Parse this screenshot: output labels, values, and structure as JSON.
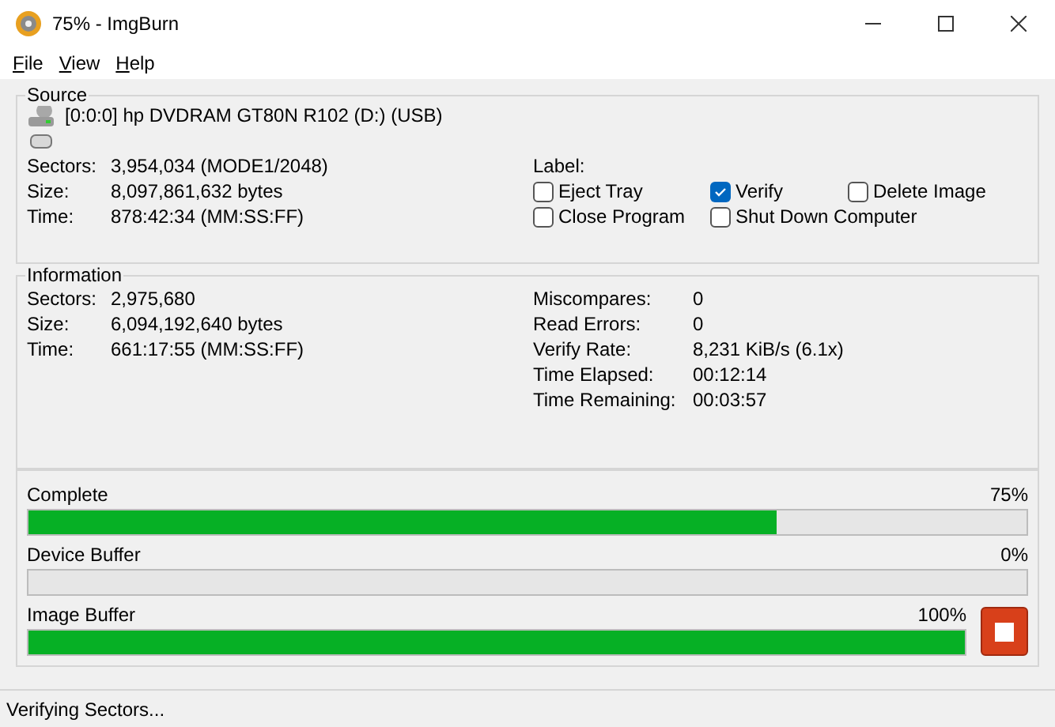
{
  "window": {
    "title": "75% - ImgBurn"
  },
  "menu": [
    {
      "label": "File"
    },
    {
      "label": "View"
    },
    {
      "label": "Help"
    }
  ],
  "source": {
    "title": "Source",
    "device": "[0:0:0] hp DVDRAM GT80N R102 (D:) (USB)",
    "fields": [
      {
        "label": "Sectors:",
        "value": "3,954,034 (MODE1/2048)"
      },
      {
        "label": "Size:",
        "value": "8,097,861,632 bytes"
      },
      {
        "label": "Time:",
        "value": "878:42:34 (MM:SS:FF)"
      }
    ],
    "label_caption": "Label:",
    "options": [
      {
        "label": "Eject Tray",
        "checked": false
      },
      {
        "label": "Verify",
        "checked": true
      },
      {
        "label": "Delete Image",
        "checked": false
      },
      {
        "label": "Close Program",
        "checked": false
      },
      {
        "label": "Shut Down Computer",
        "checked": false
      }
    ]
  },
  "information": {
    "title": "Information",
    "fields": [
      {
        "label": "Sectors:",
        "value": "2,975,680"
      },
      {
        "label": "Size:",
        "value": "6,094,192,640 bytes"
      },
      {
        "label": "Time:",
        "value": "661:17:55 (MM:SS:FF)"
      }
    ],
    "stats": [
      {
        "label": "Miscompares:",
        "value": "0"
      },
      {
        "label": "Read Errors:",
        "value": "0"
      },
      {
        "label": "Verify Rate:",
        "value": "8,231 KiB/s (6.1x)"
      },
      {
        "label": "Time Elapsed:",
        "value": "00:12:14"
      },
      {
        "label": "Time Remaining:",
        "value": "00:03:57"
      }
    ]
  },
  "progress": [
    {
      "label": "Complete",
      "reading": "75%",
      "level": 0.75
    },
    {
      "label": "Device Buffer",
      "reading": "0%",
      "level": 0
    },
    {
      "label": "Image Buffer",
      "reading": "100%",
      "level": 1
    }
  ],
  "status_bar": "Verifying Sectors..."
}
